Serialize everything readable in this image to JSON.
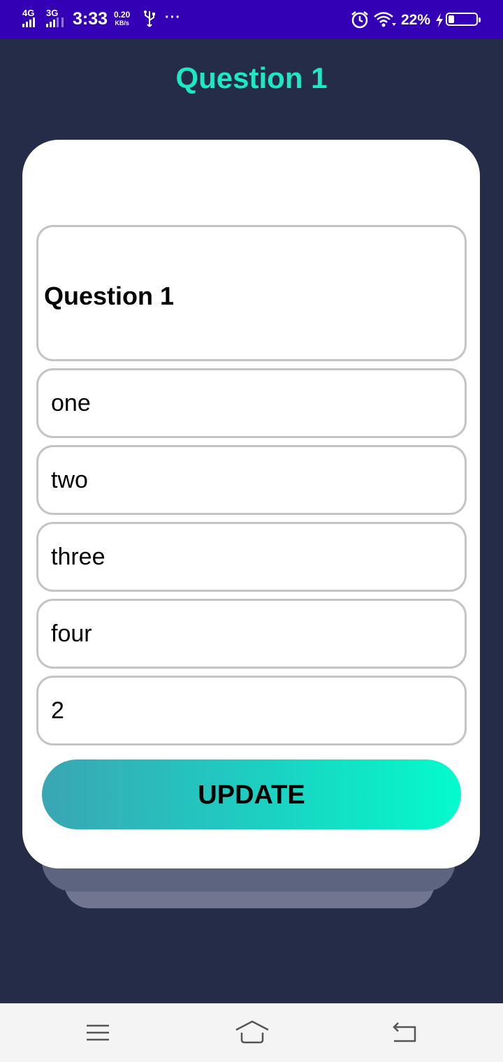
{
  "status_bar": {
    "network_1": "4G",
    "network_2": "3G",
    "time": "3:33",
    "speed_value": "0.20",
    "speed_unit": "KB/s",
    "more": "···",
    "battery_percent": "22%",
    "battery_level": 0.22,
    "icons": [
      "signal-icon",
      "usb-icon",
      "alarm-icon",
      "wifi-icon",
      "charging-icon",
      "battery-icon"
    ]
  },
  "page": {
    "title": "Question 1"
  },
  "form": {
    "question": "Question 1",
    "options": [
      "one",
      "two",
      "three",
      "four"
    ],
    "answer": "2",
    "update_label": "UPDATE"
  },
  "nav_bar": {
    "icons": [
      "menu-icon",
      "home-icon",
      "back-icon"
    ]
  },
  "colors": {
    "status_bar": "#3300b5",
    "background": "#252c48",
    "title": "#1de9c0",
    "button_start": "#3aa6b3",
    "button_end": "#04fbcc"
  }
}
